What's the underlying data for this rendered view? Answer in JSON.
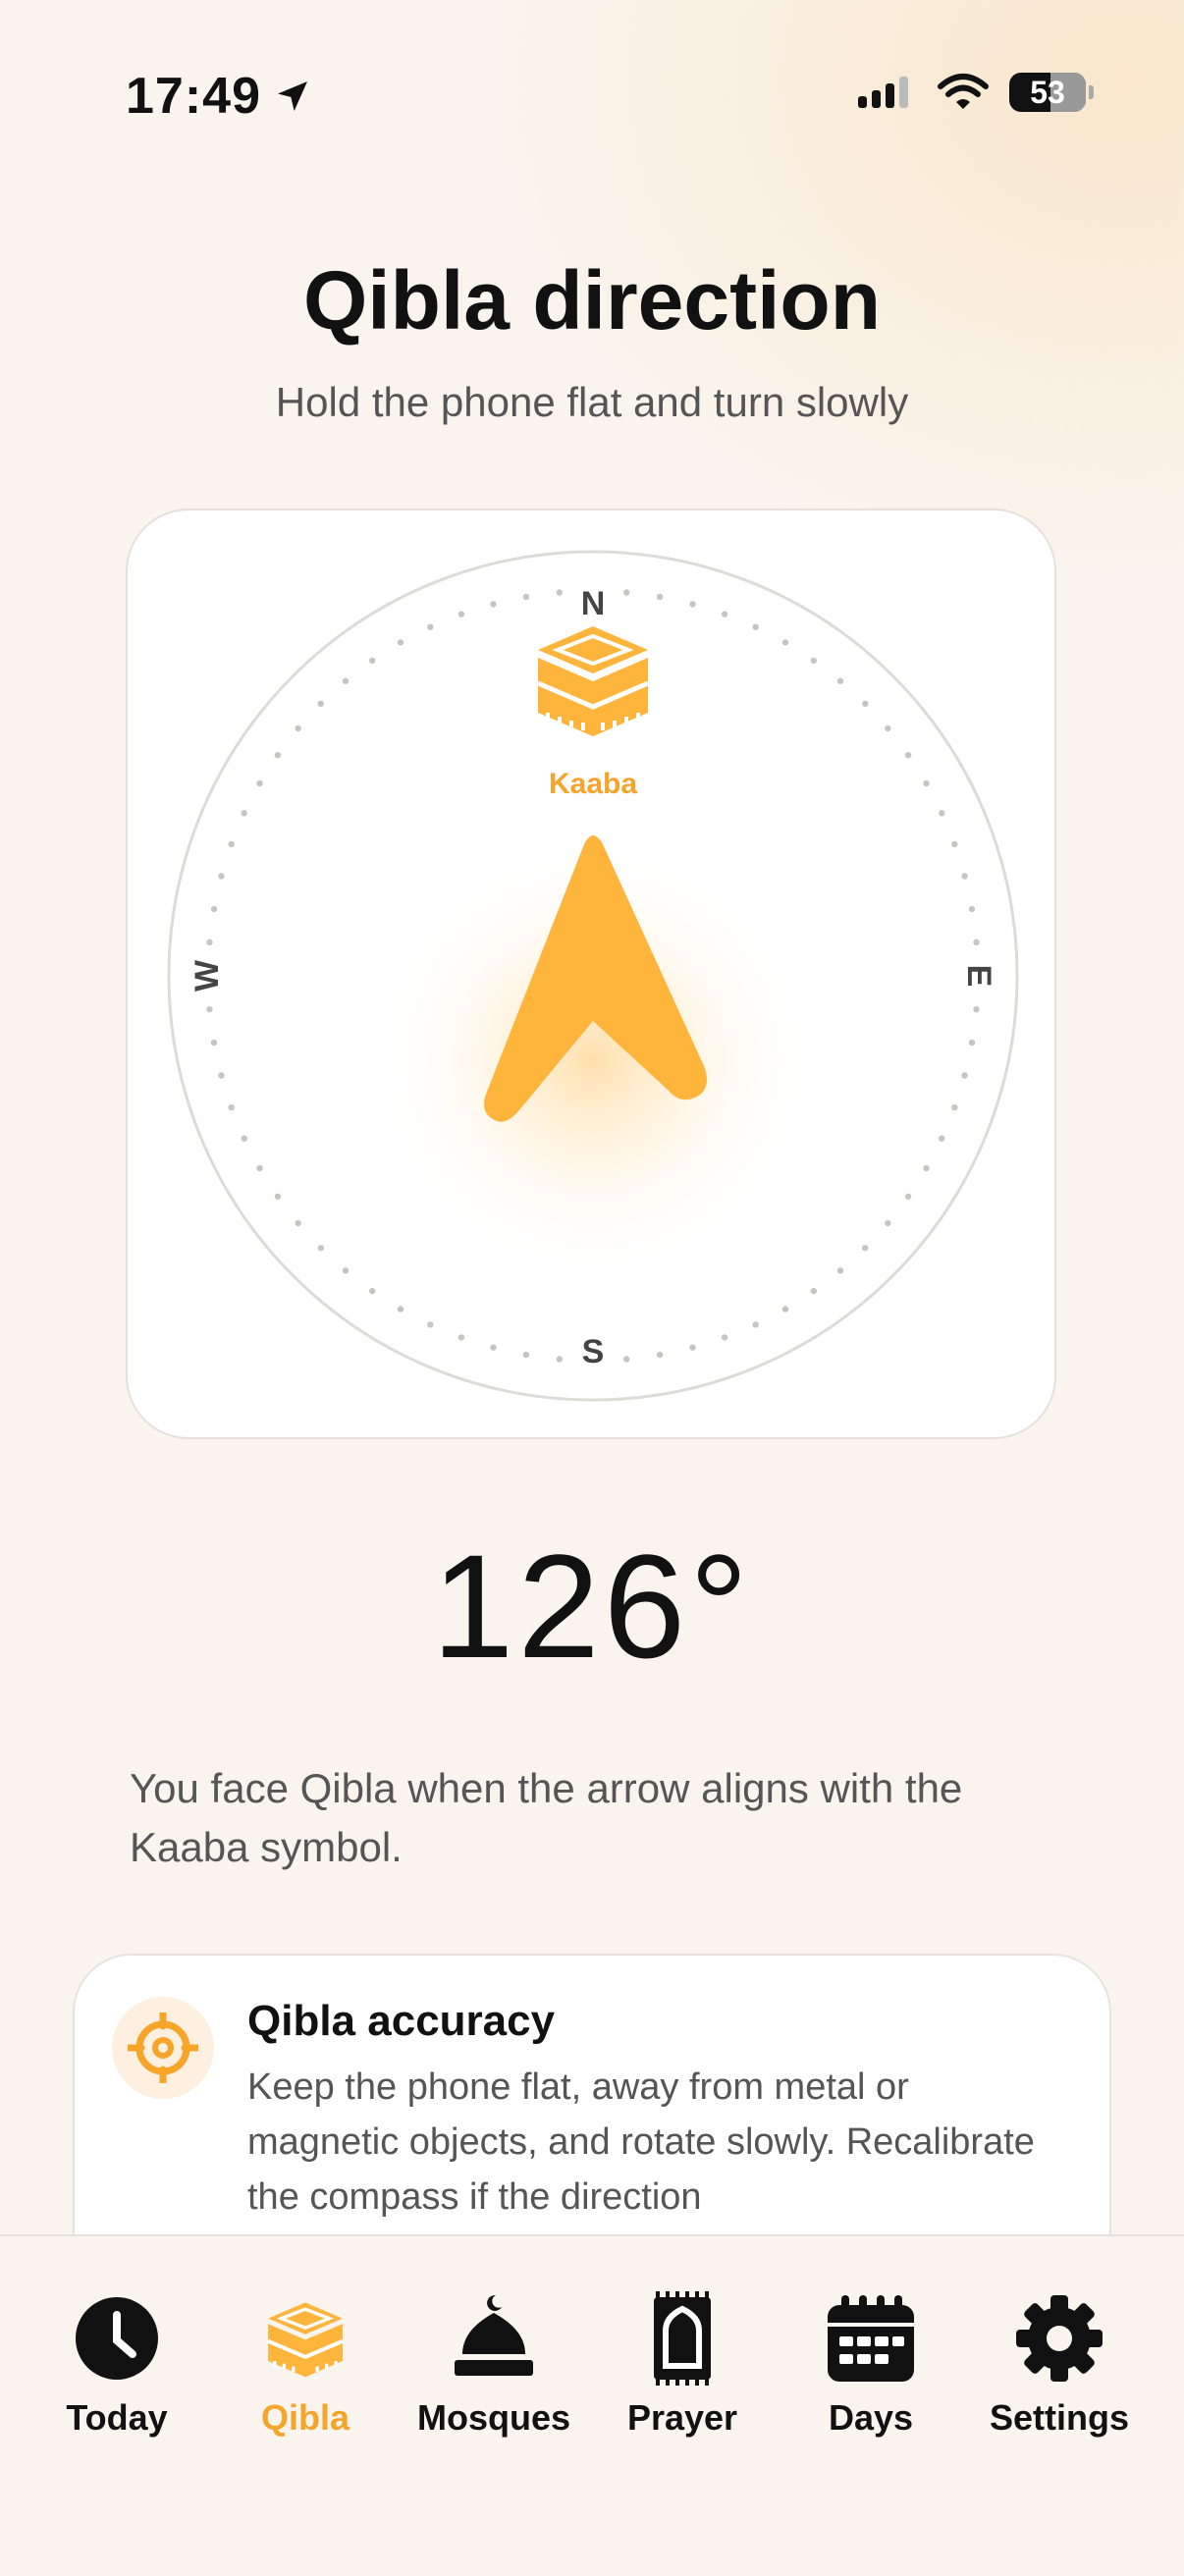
{
  "status_bar": {
    "time": "17:49",
    "battery": "53"
  },
  "header": {
    "title": "Qibla direction",
    "subtitle": "Hold the phone flat and turn slowly"
  },
  "compass": {
    "north": "N",
    "south": "S",
    "east": "E",
    "west": "W",
    "kaaba_label": "Kaaba",
    "heading_degrees": "126°",
    "accent_color": "#ffb53b"
  },
  "hint": "You face Qibla when the arrow aligns with the Kaaba symbol.",
  "accuracy_card": {
    "title": "Qibla accuracy",
    "text": "Keep the phone flat, away from metal or magnetic objects, and rotate slowly. Recalibrate the compass if the direction"
  },
  "tabs": [
    {
      "label": "Today",
      "icon": "clock-icon"
    },
    {
      "label": "Qibla",
      "icon": "kaaba-icon",
      "active": true
    },
    {
      "label": "Mosques",
      "icon": "mosque-icon"
    },
    {
      "label": "Prayer",
      "icon": "prayer-mat-icon"
    },
    {
      "label": "Days",
      "icon": "calendar-icon"
    },
    {
      "label": "Settings",
      "icon": "gear-icon"
    }
  ]
}
